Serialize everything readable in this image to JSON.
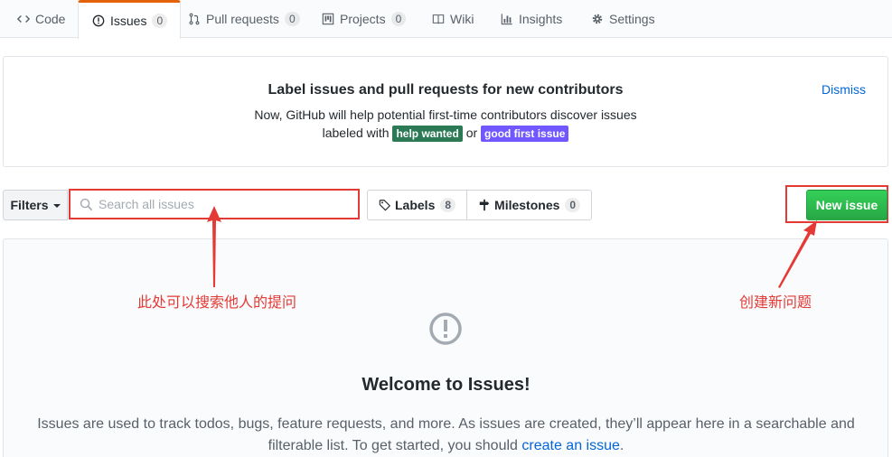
{
  "tabs": [
    {
      "label": "Code",
      "icon": "code-icon"
    },
    {
      "label": "Issues",
      "icon": "issue-opened-icon",
      "counter": "0",
      "selected": true
    },
    {
      "label": "Pull requests",
      "icon": "git-pull-request-icon",
      "counter": "0"
    },
    {
      "label": "Projects",
      "icon": "project-icon",
      "counter": "0"
    },
    {
      "label": "Wiki",
      "icon": "book-icon"
    },
    {
      "label": "Insights",
      "icon": "graph-icon"
    },
    {
      "label": "Settings",
      "icon": "gear-icon"
    }
  ],
  "banner": {
    "title": "Label issues and pull requests for new contributors",
    "line1": "Now, GitHub will help potential first-time contributors discover issues",
    "line2_prefix": "labeled with",
    "label_help": "help wanted",
    "line2_or": "or",
    "label_good": "good first issue",
    "dismiss": "Dismiss",
    "colors": {
      "help_wanted": "#2b7a55",
      "good_first_issue": "#7057ff"
    }
  },
  "filterbar": {
    "filters_label": "Filters",
    "search_placeholder": "Search all issues",
    "labels_label": "Labels",
    "labels_count": "8",
    "milestones_label": "Milestones",
    "milestones_count": "0",
    "new_issue_label": "New issue"
  },
  "blankslate": {
    "title": "Welcome to Issues!",
    "text_before": "Issues are used to track todos, bugs, feature requests, and more. As issues are created, they’ll appear here in a searchable and filterable list. To get started, you should",
    "link": "create an issue",
    "text_after": "."
  },
  "annotations": {
    "search_note": "此处可以搜索他人的提问",
    "new_issue_note": "创建新问题",
    "color": "#e53935"
  }
}
